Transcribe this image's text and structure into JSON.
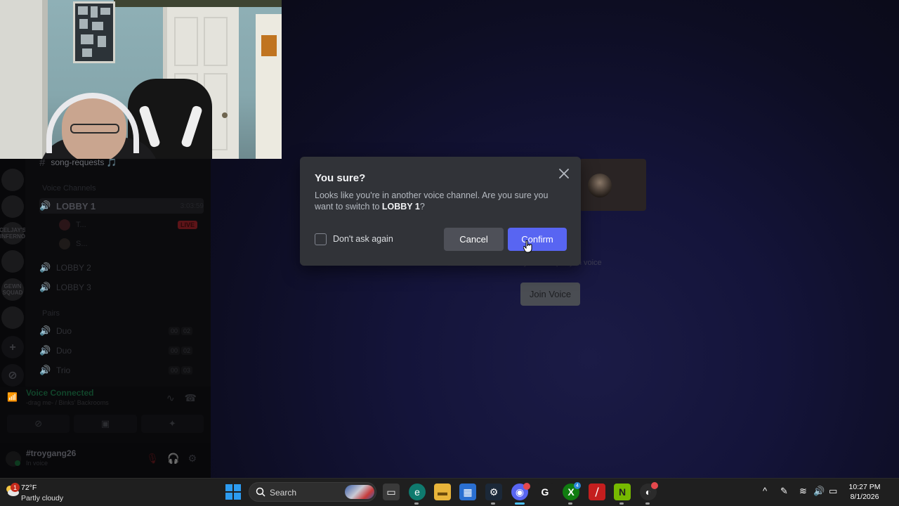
{
  "channel_sidebar": {
    "text_channel": {
      "name": "song-requests 🎵"
    },
    "voice_category": "Voice Channels",
    "voice_channels": [
      {
        "name": "LOBBY 1",
        "timer": "3:03:59",
        "active": true
      },
      {
        "name": "LOBBY 2",
        "timer": "",
        "active": false
      },
      {
        "name": "LOBBY 3",
        "timer": "",
        "active": false
      }
    ],
    "lobby1_users": [
      {
        "name": "T...",
        "badge": "LIVE"
      },
      {
        "name": "S...",
        "badge": ""
      }
    ],
    "pairs_category": "Pairs",
    "pair_channels": [
      {
        "name": "Duo",
        "count": [
          "00",
          "02"
        ]
      },
      {
        "name": "Duo",
        "count": [
          "00",
          "02"
        ]
      },
      {
        "name": "Trio",
        "count": [
          "00",
          "03"
        ]
      }
    ]
  },
  "server_rail": {
    "servers": [
      {
        "label": ""
      },
      {
        "label": ""
      },
      {
        "label": "CELJAY'S INFERNO"
      },
      {
        "label": ""
      },
      {
        "label": "GEWN SQUAD"
      },
      {
        "label": ""
      }
    ],
    "add_server_glyph": "+",
    "explore_glyph": "⊘"
  },
  "voice_panel": {
    "status": "Voice Connected",
    "location": "-drag me- / Binks' Backrooms"
  },
  "user_panel": {
    "username": "#troygang26",
    "status": "In voice"
  },
  "stage": {
    "subtext": "Nobody's in the party in voice",
    "join_button": "Join Voice"
  },
  "modal": {
    "title": "You sure?",
    "body_prefix": "Looks like you're in another voice channel. Are you sure you want to switch to ",
    "body_channel": "LOBBY 1",
    "body_suffix": "?",
    "checkbox_label": "Don't ask again",
    "checkbox_checked": false,
    "cancel_label": "Cancel",
    "confirm_label": "Confirm",
    "confirm_color": "#5865f2",
    "cancel_color": "#4e5058"
  },
  "taskbar": {
    "weather": {
      "temp": "72°F",
      "description": "Partly cloudy",
      "badge": "1"
    },
    "search_placeholder": "Search",
    "apps": [
      {
        "name": "task-view",
        "glyph": "▭"
      },
      {
        "name": "edge",
        "glyph": "e"
      },
      {
        "name": "file-explorer",
        "glyph": "▬"
      },
      {
        "name": "microsoft-store",
        "glyph": "▦"
      },
      {
        "name": "steam",
        "glyph": "⚙"
      },
      {
        "name": "discord",
        "glyph": "◉"
      },
      {
        "name": "logitech-g-hub",
        "glyph": "G"
      },
      {
        "name": "xbox",
        "glyph": "X"
      },
      {
        "name": "app-red",
        "glyph": "⧸"
      },
      {
        "name": "nvidia",
        "glyph": "N"
      },
      {
        "name": "obs",
        "glyph": "◐"
      }
    ],
    "xbox_badge": "4",
    "clock": {
      "time": "10:27 PM",
      "date": "8/1/2026"
    }
  }
}
